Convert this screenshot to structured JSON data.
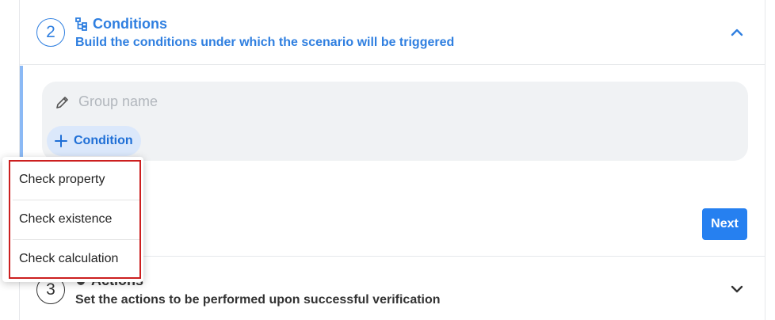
{
  "step2": {
    "number": "2",
    "title": "Conditions",
    "subtitle": "Build the conditions under which the scenario will be triggered",
    "title_icon": "tree-structure-icon",
    "collapse_icon": "chevron-up-icon"
  },
  "conditions": {
    "group_name_placeholder": "Group name",
    "group_name_value": "",
    "add_condition_label": "Condition",
    "next_label": "Next"
  },
  "step3": {
    "number": "3",
    "title": "Actions",
    "subtitle": "Set the actions to be performed upon successful verification",
    "expand_icon": "chevron-down-icon"
  },
  "dropdown": {
    "items": [
      {
        "label": "Check property"
      },
      {
        "label": "Check existence"
      },
      {
        "label": "Check calculation"
      }
    ]
  },
  "colors": {
    "accent": "#2f7fe0",
    "primary_button": "#2680f0",
    "highlight_outline": "#cc1f1f"
  }
}
